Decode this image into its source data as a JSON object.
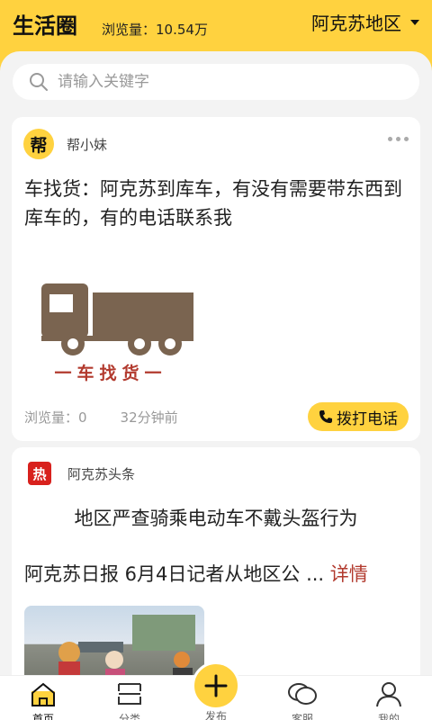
{
  "header": {
    "title": "生活圈",
    "views": "浏览量：10.54万",
    "region": "阿克苏地区"
  },
  "search": {
    "placeholder": "请输入关键字"
  },
  "posts": [
    {
      "author": "帮小妹",
      "avatar_text": "帮",
      "text": "车找货：阿克苏到库车，有没有需要带东西到库车的，有的电话联系我",
      "image_caption": "一车找货一",
      "views": "浏览量：0",
      "time": "32分钟前",
      "call_label": "拨打电话"
    },
    {
      "author": "阿克苏头条",
      "avatar_text": "热",
      "headline": "地区严查骑乘电动车不戴头盔行为",
      "excerpt": "阿克苏日报 6月4日记者从地区公 ...",
      "detail_label": "详情"
    }
  ],
  "tabs": [
    {
      "label": "首页"
    },
    {
      "label": "分类"
    },
    {
      "label": "发布"
    },
    {
      "label": "客服"
    },
    {
      "label": "我的"
    }
  ],
  "colors": {
    "accent": "#ffd23f",
    "brand_red": "#b23a2e"
  }
}
